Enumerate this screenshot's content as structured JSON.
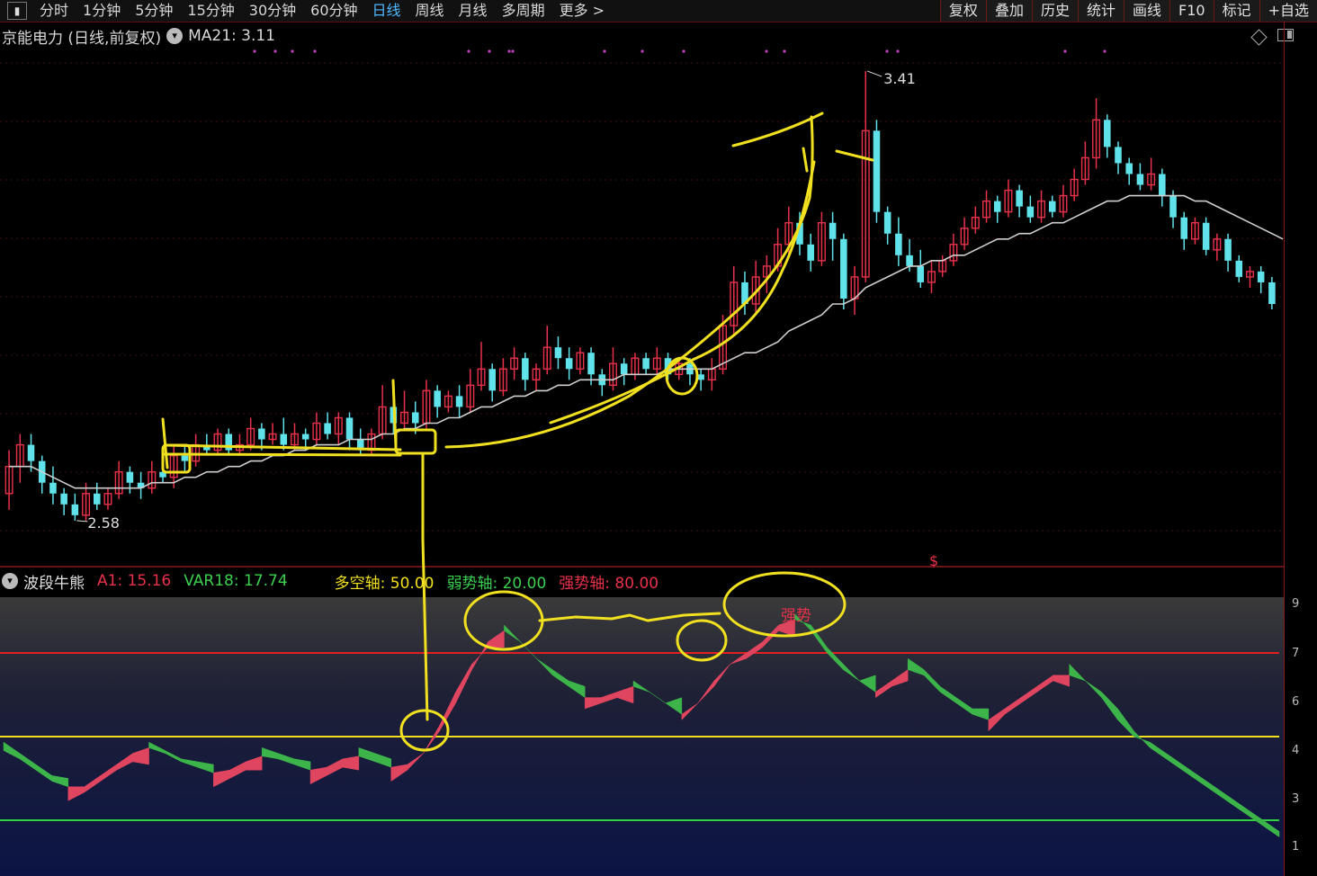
{
  "toolbar": {
    "periods": [
      "分时",
      "1分钟",
      "5分钟",
      "15分钟",
      "30分钟",
      "60分钟",
      "日线",
      "周线",
      "月线",
      "多周期",
      "更多 >"
    ],
    "active_index": 6,
    "buttons": [
      "复权",
      "叠加",
      "历史",
      "统计",
      "画线",
      "F10",
      "标记",
      "+自选"
    ]
  },
  "price_panel": {
    "stock_label": "京能电力 (日线,前复权)",
    "ma_label": "MA21: 3.11",
    "high_label": "3.41",
    "low_label": "2.58",
    "marker": "$"
  },
  "indicator_panel": {
    "name": "波段牛熊",
    "a1_label": "A1: 15.16",
    "var18_label": "VAR18: 17.74",
    "duokong_label": "多空轴: 50.00",
    "ruoshi_label": "弱势轴: 20.00",
    "qiangshi_label": "强势轴: 80.00",
    "zone_label": "强势"
  },
  "right_axis": {
    "indicator_ticks": [
      "9",
      "7",
      "6",
      "4",
      "3",
      "1"
    ]
  },
  "colors": {
    "up": "#e8314a",
    "down": "#5fe2ea",
    "ma": "#cfcfcf",
    "indicator_up": "#e04560",
    "indicator_down": "#3cb44a",
    "annotation": "#f0e020",
    "active_tab": "#4fb8ff"
  },
  "chart_data": {
    "type": "candlestick",
    "candles": [
      [
        2.63,
        2.68,
        2.71,
        2.6
      ],
      [
        2.68,
        2.72,
        2.74,
        2.65
      ],
      [
        2.72,
        2.69,
        2.74,
        2.67
      ],
      [
        2.69,
        2.65,
        2.7,
        2.63
      ],
      [
        2.65,
        2.63,
        2.68,
        2.61
      ],
      [
        2.63,
        2.61,
        2.64,
        2.59
      ],
      [
        2.61,
        2.59,
        2.63,
        2.58
      ],
      [
        2.59,
        2.63,
        2.65,
        2.58
      ],
      [
        2.63,
        2.61,
        2.65,
        2.6
      ],
      [
        2.61,
        2.63,
        2.64,
        2.6
      ],
      [
        2.63,
        2.67,
        2.69,
        2.62
      ],
      [
        2.67,
        2.65,
        2.68,
        2.63
      ],
      [
        2.65,
        2.64,
        2.67,
        2.62
      ],
      [
        2.64,
        2.67,
        2.69,
        2.63
      ],
      [
        2.67,
        2.66,
        2.69,
        2.65
      ],
      [
        2.66,
        2.7,
        2.72,
        2.64
      ],
      [
        2.7,
        2.69,
        2.72,
        2.67
      ],
      [
        2.69,
        2.72,
        2.74,
        2.68
      ],
      [
        2.72,
        2.71,
        2.74,
        2.7
      ],
      [
        2.71,
        2.74,
        2.75,
        2.7
      ],
      [
        2.74,
        2.71,
        2.75,
        2.7
      ],
      [
        2.71,
        2.72,
        2.74,
        2.7
      ],
      [
        2.72,
        2.75,
        2.77,
        2.71
      ],
      [
        2.75,
        2.73,
        2.76,
        2.71
      ],
      [
        2.73,
        2.74,
        2.76,
        2.72
      ],
      [
        2.74,
        2.72,
        2.77,
        2.71
      ],
      [
        2.72,
        2.74,
        2.76,
        2.71
      ],
      [
        2.74,
        2.73,
        2.75,
        2.71
      ],
      [
        2.73,
        2.76,
        2.78,
        2.72
      ],
      [
        2.76,
        2.74,
        2.78,
        2.73
      ],
      [
        2.74,
        2.77,
        2.78,
        2.72
      ],
      [
        2.77,
        2.73,
        2.78,
        2.71
      ],
      [
        2.73,
        2.71,
        2.75,
        2.7
      ],
      [
        2.71,
        2.74,
        2.75,
        2.7
      ],
      [
        2.74,
        2.79,
        2.83,
        2.73
      ],
      [
        2.79,
        2.76,
        2.8,
        2.74
      ],
      [
        2.76,
        2.78,
        2.82,
        2.75
      ],
      [
        2.78,
        2.76,
        2.8,
        2.74
      ],
      [
        2.76,
        2.82,
        2.84,
        2.75
      ],
      [
        2.82,
        2.79,
        2.83,
        2.77
      ],
      [
        2.79,
        2.81,
        2.82,
        2.78
      ],
      [
        2.81,
        2.79,
        2.83,
        2.77
      ],
      [
        2.79,
        2.83,
        2.86,
        2.78
      ],
      [
        2.83,
        2.86,
        2.91,
        2.82
      ],
      [
        2.86,
        2.82,
        2.87,
        2.8
      ],
      [
        2.82,
        2.86,
        2.88,
        2.81
      ],
      [
        2.86,
        2.88,
        2.9,
        2.84
      ],
      [
        2.88,
        2.84,
        2.89,
        2.82
      ],
      [
        2.84,
        2.86,
        2.87,
        2.82
      ],
      [
        2.86,
        2.9,
        2.94,
        2.85
      ],
      [
        2.9,
        2.88,
        2.92,
        2.86
      ],
      [
        2.88,
        2.86,
        2.9,
        2.84
      ],
      [
        2.86,
        2.89,
        2.9,
        2.85
      ],
      [
        2.89,
        2.85,
        2.9,
        2.83
      ],
      [
        2.85,
        2.83,
        2.86,
        2.81
      ],
      [
        2.83,
        2.87,
        2.9,
        2.82
      ],
      [
        2.87,
        2.85,
        2.88,
        2.83
      ],
      [
        2.85,
        2.88,
        2.89,
        2.84
      ],
      [
        2.88,
        2.86,
        2.89,
        2.85
      ],
      [
        2.86,
        2.88,
        2.9,
        2.85
      ],
      [
        2.88,
        2.85,
        2.89,
        2.84
      ],
      [
        2.85,
        2.87,
        2.88,
        2.84
      ],
      [
        2.87,
        2.85,
        2.88,
        2.83
      ],
      [
        2.85,
        2.84,
        2.86,
        2.82
      ],
      [
        2.84,
        2.86,
        2.88,
        2.82
      ],
      [
        2.86,
        2.94,
        2.96,
        2.85
      ],
      [
        2.94,
        3.02,
        3.05,
        2.92
      ],
      [
        3.02,
        2.98,
        3.04,
        2.96
      ],
      [
        2.98,
        3.03,
        3.06,
        2.96
      ],
      [
        3.03,
        3.05,
        3.07,
        3.0
      ],
      [
        3.05,
        3.09,
        3.12,
        3.04
      ],
      [
        3.09,
        3.13,
        3.16,
        3.07
      ],
      [
        3.13,
        3.09,
        3.15,
        3.07
      ],
      [
        3.09,
        3.06,
        3.11,
        3.04
      ],
      [
        3.06,
        3.13,
        3.15,
        3.05
      ],
      [
        3.13,
        3.1,
        3.15,
        3.06
      ],
      [
        3.1,
        2.99,
        3.11,
        2.97
      ],
      [
        2.99,
        3.03,
        3.05,
        2.96
      ],
      [
        3.03,
        3.3,
        3.41,
        3.02
      ],
      [
        3.3,
        3.15,
        3.32,
        3.13
      ],
      [
        3.15,
        3.11,
        3.16,
        3.09
      ],
      [
        3.11,
        3.07,
        3.14,
        3.05
      ],
      [
        3.07,
        3.05,
        3.1,
        3.04
      ],
      [
        3.05,
        3.02,
        3.08,
        3.01
      ],
      [
        3.02,
        3.04,
        3.06,
        3.0
      ],
      [
        3.04,
        3.06,
        3.07,
        3.03
      ],
      [
        3.06,
        3.09,
        3.11,
        3.05
      ],
      [
        3.09,
        3.12,
        3.14,
        3.08
      ],
      [
        3.12,
        3.14,
        3.16,
        3.11
      ],
      [
        3.14,
        3.17,
        3.19,
        3.13
      ],
      [
        3.17,
        3.15,
        3.18,
        3.13
      ],
      [
        3.15,
        3.19,
        3.21,
        3.14
      ],
      [
        3.19,
        3.16,
        3.2,
        3.14
      ],
      [
        3.16,
        3.14,
        3.18,
        3.13
      ],
      [
        3.14,
        3.17,
        3.19,
        3.13
      ],
      [
        3.17,
        3.15,
        3.18,
        3.14
      ],
      [
        3.15,
        3.18,
        3.2,
        3.14
      ],
      [
        3.18,
        3.21,
        3.23,
        3.17
      ],
      [
        3.21,
        3.25,
        3.28,
        3.2
      ],
      [
        3.25,
        3.32,
        3.36,
        3.23
      ],
      [
        3.32,
        3.27,
        3.33,
        3.25
      ],
      [
        3.27,
        3.24,
        3.28,
        3.22
      ],
      [
        3.24,
        3.22,
        3.25,
        3.2
      ],
      [
        3.22,
        3.2,
        3.24,
        3.19
      ],
      [
        3.2,
        3.22,
        3.25,
        3.19
      ],
      [
        3.22,
        3.18,
        3.23,
        3.16
      ],
      [
        3.18,
        3.14,
        3.19,
        3.12
      ],
      [
        3.14,
        3.1,
        3.15,
        3.08
      ],
      [
        3.1,
        3.13,
        3.14,
        3.09
      ],
      [
        3.13,
        3.08,
        3.14,
        3.07
      ],
      [
        3.08,
        3.1,
        3.11,
        3.06
      ],
      [
        3.1,
        3.06,
        3.11,
        3.04
      ],
      [
        3.06,
        3.03,
        3.07,
        3.02
      ],
      [
        3.03,
        3.04,
        3.05,
        3.01
      ],
      [
        3.04,
        3.02,
        3.05,
        3.0
      ],
      [
        3.02,
        2.98,
        3.03,
        2.97
      ]
    ],
    "ma21": [
      2.68,
      2.68,
      2.68,
      2.67,
      2.66,
      2.65,
      2.64,
      2.64,
      2.64,
      2.64,
      2.64,
      2.64,
      2.64,
      2.65,
      2.65,
      2.65,
      2.66,
      2.66,
      2.67,
      2.67,
      2.68,
      2.68,
      2.69,
      2.69,
      2.7,
      2.7,
      2.71,
      2.71,
      2.72,
      2.72,
      2.72,
      2.73,
      2.73,
      2.73,
      2.74,
      2.74,
      2.75,
      2.75,
      2.76,
      2.76,
      2.77,
      2.77,
      2.78,
      2.79,
      2.79,
      2.8,
      2.81,
      2.81,
      2.82,
      2.82,
      2.83,
      2.83,
      2.84,
      2.84,
      2.84,
      2.84,
      2.85,
      2.85,
      2.85,
      2.85,
      2.86,
      2.86,
      2.86,
      2.86,
      2.86,
      2.87,
      2.88,
      2.89,
      2.89,
      2.9,
      2.91,
      2.93,
      2.94,
      2.95,
      2.96,
      2.98,
      2.98,
      2.99,
      3.01,
      3.02,
      3.03,
      3.04,
      3.05,
      3.05,
      3.06,
      3.06,
      3.07,
      3.07,
      3.08,
      3.09,
      3.1,
      3.1,
      3.11,
      3.11,
      3.12,
      3.13,
      3.13,
      3.14,
      3.15,
      3.16,
      3.17,
      3.17,
      3.18,
      3.18,
      3.18,
      3.18,
      3.18,
      3.18,
      3.17,
      3.17,
      3.16,
      3.15,
      3.14,
      3.13,
      3.12,
      3.11,
      3.1
    ],
    "y_range": [
      2.52,
      3.45
    ],
    "indicator": {
      "a1": [
        45,
        42,
        38,
        34,
        32,
        32,
        36,
        40,
        44,
        46,
        44,
        41,
        39,
        37,
        38,
        41,
        43,
        42,
        40,
        38,
        39,
        42,
        43,
        41,
        39,
        40,
        44,
        52,
        62,
        74,
        84,
        88,
        84,
        78,
        72,
        68,
        64,
        64,
        66,
        68,
        66,
        62,
        58,
        62,
        68,
        76,
        80,
        84,
        90,
        92,
        90,
        82,
        76,
        70,
        66,
        70,
        74,
        72,
        66,
        62,
        58,
        56,
        60,
        64,
        68,
        72,
        72,
        70,
        66,
        60,
        52,
        46,
        42,
        38,
        34,
        30,
        26,
        22,
        18,
        14
      ],
      "var18": [
        44,
        40,
        36,
        32,
        31,
        34,
        38,
        42,
        45,
        44,
        41,
        38,
        37,
        36,
        39,
        42,
        42,
        40,
        38,
        37,
        40,
        43,
        42,
        40,
        38,
        42,
        48,
        58,
        70,
        80,
        86,
        86,
        80,
        74,
        70,
        66,
        64,
        66,
        68,
        66,
        62,
        58,
        60,
        66,
        74,
        80,
        82,
        86,
        92,
        90,
        84,
        76,
        70,
        66,
        68,
        72,
        74,
        70,
        64,
        60,
        56,
        56,
        62,
        66,
        70,
        74,
        72,
        66,
        60,
        52,
        46,
        44,
        40,
        36,
        32,
        28,
        24,
        20,
        16,
        12
      ],
      "lines": {
        "duokong": 50,
        "ruoshi": 20,
        "qiangshi": 80
      },
      "y_range": [
        0,
        100
      ]
    }
  }
}
